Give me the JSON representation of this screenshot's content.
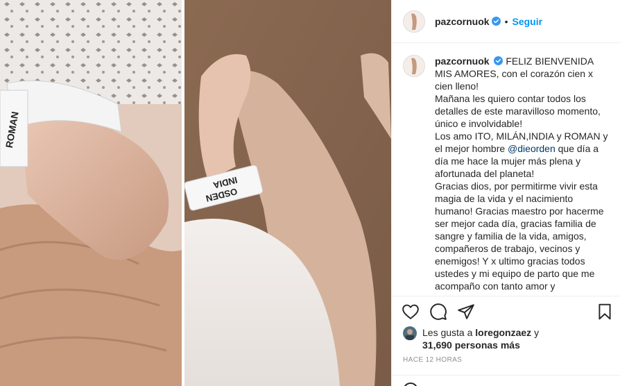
{
  "post": {
    "username": "pazcornuok",
    "separator": "•",
    "follow_label": "Seguir",
    "photo_band_left": "INDIA OSDEN",
    "photo_band_right_line1": "INDIA",
    "photo_band_right_line2": "OSDEN",
    "caption": {
      "intro": "FELIZ BIENVENIDA MIS AMORES, con el corazón cien x cien lleno!",
      "line2": "Mañana les quiero contar todos los detalles de este maravilloso momento, único e involvidable!",
      "line3_before": "Los amo ITO, MILÁN,INDIA y ROMAN y el mejor hombre ",
      "mention": "@dieorden",
      "line3_after": " que día a día me hace la mujer más plena y afortunada del planeta!",
      "line4": "Gracias dios, por permitirme vivir esta magia de la vida y el nacimiento humano! Gracias maestro por hacerme ser mejor cada día, gracias familia de sangre y familia de la vida, amigos, compañeros de trabajo, vecinos y enemigos! Y x ultimo gracias todos ustedes y mi equipo de parto que me acompaño con tanto amor y"
    },
    "likes": {
      "prefix": "Les gusta a ",
      "liker": "loregonzaez",
      "middle": " y",
      "count": "31,690 personas más"
    },
    "time": "HACE 12 HORAS"
  },
  "icons": {
    "like": "heart-icon",
    "comment": "comment-icon",
    "share": "paper-plane-icon",
    "save": "bookmark-icon",
    "verified": "verified-badge-icon"
  },
  "colors": {
    "accent": "#0095f6",
    "verified": "#3897f0",
    "mention": "#00376b",
    "muted": "#8e8e8e"
  }
}
